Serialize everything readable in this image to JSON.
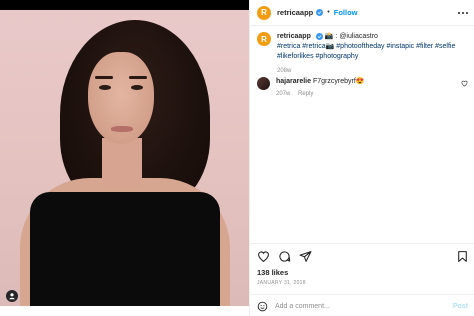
{
  "post": {
    "username": "retricaapp",
    "avatar_letter": "R",
    "follow_label": "Follow",
    "separator": "•",
    "caption_username": "retricaapp",
    "caption_text": "📸 : @iuliacastro",
    "hashtags": "#retrica #retrica📷 #photooftheday #instapic #filter #selfie #likeforlikes #photography",
    "caption_time": "208w",
    "likes": "138 likes",
    "date": "JANUARY 31, 2018"
  },
  "comment": {
    "username": "hajararelie",
    "text": "F7grzcyrebyrf😍",
    "time": "207w",
    "reply_label": "Reply"
  },
  "composer": {
    "placeholder": "Add a comment...",
    "post_label": "Post"
  },
  "colors": {
    "accent": "#0095f6",
    "brand": "#f39c12",
    "verified": "#3897f0"
  }
}
